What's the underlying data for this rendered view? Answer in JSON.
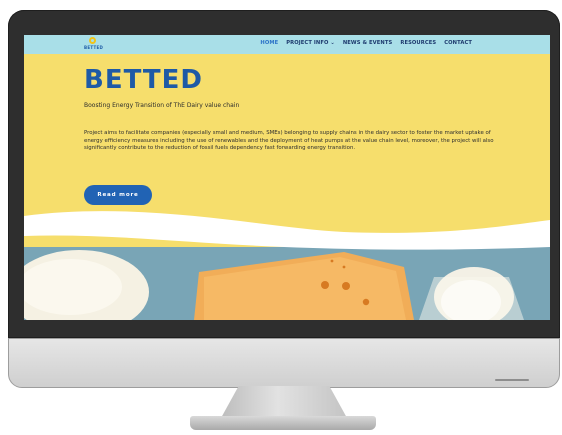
{
  "site": {
    "logo_text": "BETTED",
    "nav": [
      {
        "label": "HOME",
        "active": true
      },
      {
        "label": "PROJECT INFO ⌄",
        "active": false
      },
      {
        "label": "NEWS & EVENTS",
        "active": false
      },
      {
        "label": "RESOURCES",
        "active": false
      },
      {
        "label": "CONTACT",
        "active": false
      }
    ],
    "hero": {
      "title": "BETTED",
      "subtitle": "Boosting Energy Transition of ThE Dairy value chain",
      "description": "Project aims to facilitate companies (especially small and medium, SMEs) belonging to supply chains in the dairy sector to foster the market uptake of energy efficiency measures including the use of renewables and the deployment of heat pumps at the value chain level, moreover, the project will also significantly contribute to the reduction of fossil fuels dependency fast forwarding energy transition.",
      "button_label": "Read more"
    }
  },
  "colors": {
    "hero_bg": "#f6de6c",
    "nav_bg": "#a9dfe8",
    "brand_blue": "#1e5aa6",
    "button_blue": "#2163b4"
  },
  "icons": {
    "logo": "betted-logo-icon"
  }
}
